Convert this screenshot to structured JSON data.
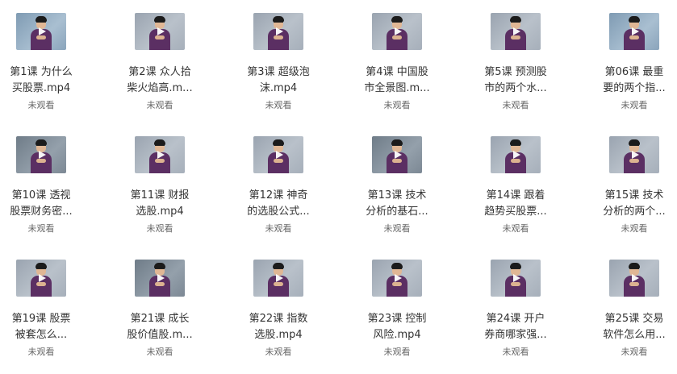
{
  "videos": [
    {
      "line1": "第1课 为什么",
      "line2": "买股票.mp4",
      "status": "未观看",
      "icon": "play-icon"
    },
    {
      "line1": "第2课 众人拾",
      "line2": "柴火焰高.m...",
      "status": "未观看",
      "icon": "play-icon"
    },
    {
      "line1": "第3课 超级泡",
      "line2": "沫.mp4",
      "status": "未观看",
      "icon": "play-icon"
    },
    {
      "line1": "第4课 中国股",
      "line2": "市全景图.m...",
      "status": "未观看",
      "icon": "play-icon"
    },
    {
      "line1": "第5课 预测股",
      "line2": "市的两个水...",
      "status": "未观看",
      "icon": "play-icon"
    },
    {
      "line1": "第06课 最重",
      "line2": "要的两个指...",
      "status": "未观看",
      "icon": "play-icon"
    },
    {
      "line1": "第10课 透视",
      "line2": "股票财务密...",
      "status": "未观看",
      "icon": "play-icon"
    },
    {
      "line1": "第11课 财报",
      "line2": "选股.mp4",
      "status": "未观看",
      "icon": "play-icon"
    },
    {
      "line1": "第12课 神奇",
      "line2": "的选股公式...",
      "status": "未观看",
      "icon": "play-icon"
    },
    {
      "line1": "第13课 技术",
      "line2": "分析的基石...",
      "status": "未观看",
      "icon": "play-icon"
    },
    {
      "line1": "第14课 跟着",
      "line2": "趋势买股票...",
      "status": "未观看",
      "icon": "play-icon"
    },
    {
      "line1": "第15课 技术",
      "line2": "分析的两个...",
      "status": "未观看",
      "icon": "play-icon"
    },
    {
      "line1": "第19课 股票",
      "line2": "被套怎么...",
      "status": "未观看",
      "icon": "play-icon"
    },
    {
      "line1": "第21课 成长",
      "line2": "股价值股.m...",
      "status": "未观看",
      "icon": "play-icon"
    },
    {
      "line1": "第22课 指数",
      "line2": "选股.mp4",
      "status": "未观看",
      "icon": "play-icon"
    },
    {
      "line1": "第23课 控制",
      "line2": "风险.mp4",
      "status": "未观看",
      "icon": "play-icon"
    },
    {
      "line1": "第24课 开户",
      "line2": "券商哪家强...",
      "status": "未观看",
      "icon": "play-icon"
    },
    {
      "line1": "第25课 交易",
      "line2": "软件怎么用...",
      "status": "未观看",
      "icon": "play-icon"
    }
  ]
}
